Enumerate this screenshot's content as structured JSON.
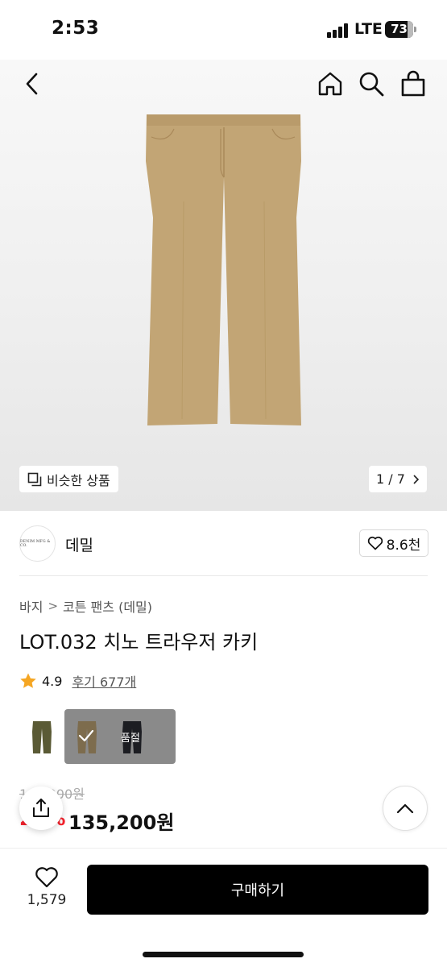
{
  "status_bar": {
    "time": "2:53",
    "network": "LTE",
    "battery": "73"
  },
  "nav": {
    "icons": [
      "back-chevron-icon",
      "home-icon",
      "search-icon",
      "shopping-bag-icon"
    ]
  },
  "gallery": {
    "similar_label": "비슷한 상품",
    "counter": "1 / 7",
    "product_color": "#c2a575"
  },
  "brand": {
    "logo_text": "DENIM MFG & CO.",
    "name": "데밀",
    "likes": "8.6천"
  },
  "product": {
    "breadcrumb": [
      "바지",
      "코튼 팬츠 (데밀)"
    ],
    "title": "LOT.032 치노 트라우저 카키",
    "rating": "4.9",
    "reviews": "후기 677개",
    "swatches": [
      {
        "color": "#5a5a35",
        "state": "available"
      },
      {
        "color": "#8c7a55",
        "state": "selected"
      },
      {
        "color": "#1c1d22",
        "state": "soldout"
      }
    ],
    "soldout_label": "품절",
    "old_price": "169,000원",
    "discount": "20%",
    "price": "135,200원"
  },
  "bottom_bar": {
    "wish_count": "1,579",
    "buy_label": "구매하기"
  },
  "colors": {
    "accent_red": "#f5222d",
    "primary": "#000000",
    "star": "#f5a623"
  }
}
